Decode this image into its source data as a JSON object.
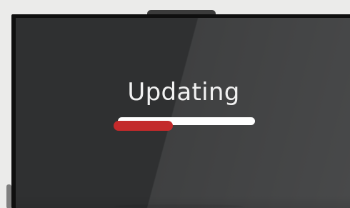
{
  "status": {
    "title": "Updating",
    "progress_fraction": 0.43
  },
  "colors": {
    "background": "#ebebea",
    "monitor_frame": "#0f0f0f",
    "screen": "#2f3031",
    "text": "#f1f1f1",
    "progress_track": "#ffffff",
    "progress_fill": "#c32a2b"
  }
}
